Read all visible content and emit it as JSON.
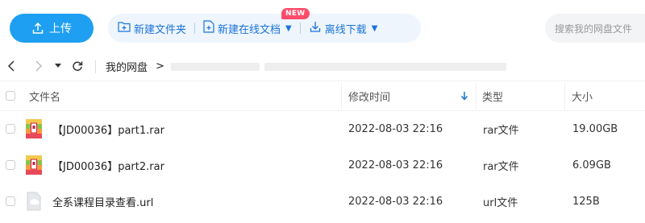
{
  "toolbar": {
    "upload_label": "上传",
    "new_folder_label": "新建文件夹",
    "new_online_doc_label": "新建在线文档",
    "new_badge": "NEW",
    "offline_download_label": "离线下载",
    "search_placeholder": "搜索我的网盘文件"
  },
  "breadcrumb": {
    "root": "我的网盘",
    "separator": ">"
  },
  "table": {
    "columns": {
      "name": "文件名",
      "modified": "修改时间",
      "type": "类型",
      "size": "大小"
    },
    "sort_column": "modified",
    "rows": [
      {
        "name": "【JD00036】part1.rar",
        "modified": "2022-08-03 22:16",
        "type": "rar文件",
        "size": "19.00GB",
        "icon": "rar-archive-icon"
      },
      {
        "name": "【JD00036】part2.rar",
        "modified": "2022-08-03 22:16",
        "type": "rar文件",
        "size": "6.09GB",
        "icon": "rar-archive-icon"
      },
      {
        "name": "全系课程目录查看.url",
        "modified": "2022-08-03 22:16",
        "type": "url文件",
        "size": "125B",
        "icon": "url-file-icon"
      }
    ]
  },
  "colors": {
    "primary": "#1e9ff2",
    "action_text": "#1a73d9",
    "action_bg": "#eef5fd",
    "badge": "#ff4c6a"
  }
}
